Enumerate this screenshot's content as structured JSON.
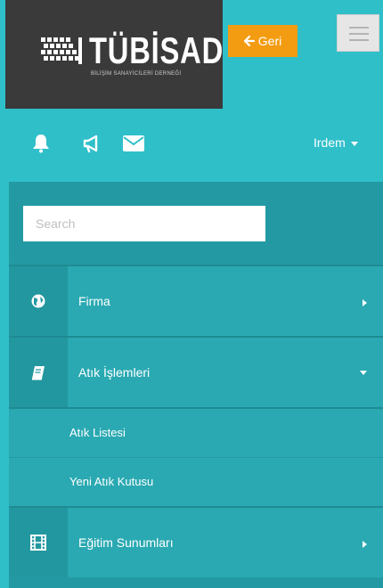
{
  "brand": {
    "name": "TÜBİSAD",
    "subtitle": "BİLİŞİM SANAYİCİLERİ DERNEĞİ"
  },
  "header": {
    "back_label": "Geri",
    "user_name": "Irdem"
  },
  "search": {
    "placeholder": "Search"
  },
  "menu": {
    "items": [
      {
        "label": "Firma",
        "icon": "globe-icon",
        "expanded": false
      },
      {
        "label": "Atık İşlemleri",
        "icon": "book-icon",
        "expanded": true,
        "children": [
          {
            "label": "Atık Listesi"
          },
          {
            "label": "Yeni Atık Kutusu"
          }
        ]
      },
      {
        "label": "Eğitim Sunumları",
        "icon": "film-icon",
        "expanded": false
      }
    ]
  },
  "colors": {
    "accent": "#2fbfc9",
    "panel": "#239aa3",
    "button_orange": "#f39c12",
    "logo_bg": "#3a3a3a"
  }
}
